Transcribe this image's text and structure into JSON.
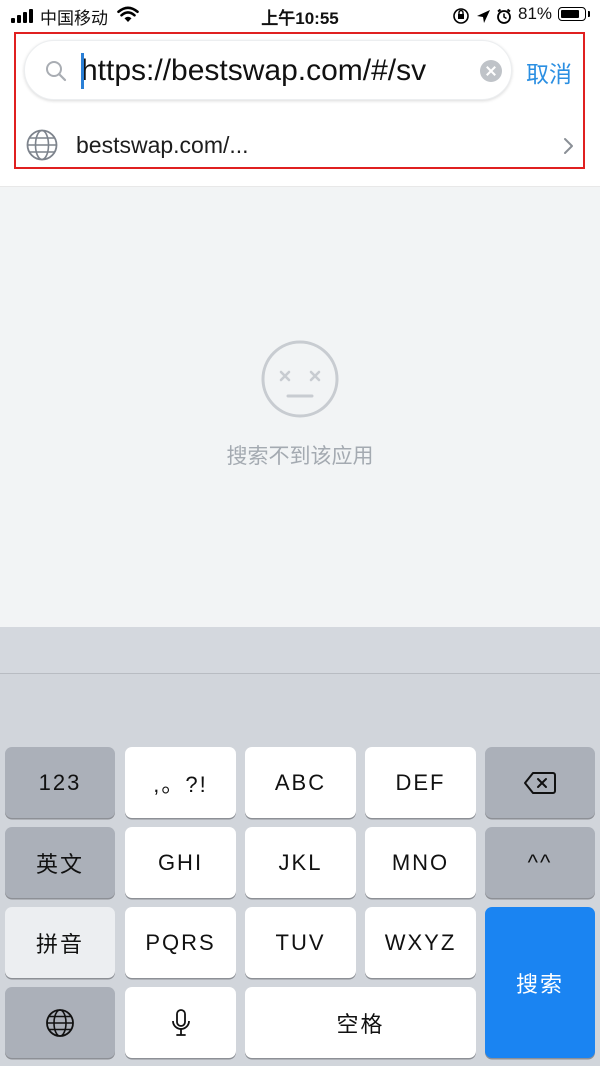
{
  "status_bar": {
    "carrier": "中国移动",
    "time": "上午10:55",
    "battery": "81%",
    "battery_level": 0.81
  },
  "search": {
    "value": "https://bestswap.com/#/sv",
    "cancel_label": "取消",
    "icons": [
      "search-icon",
      "clear-icon"
    ]
  },
  "suggestion": {
    "text": "bestswap.com/...",
    "icons": [
      "globe-icon",
      "chevron-right-icon"
    ]
  },
  "empty_state": {
    "message": "搜索不到该应用",
    "icon": "neutral-face-icon"
  },
  "keyboard": {
    "row1": [
      "123",
      ",。?!",
      "ABC",
      "DEF"
    ],
    "row2": [
      "英文",
      "GHI",
      "JKL",
      "MNO",
      "^^"
    ],
    "row3": [
      "拼音",
      "PQRS",
      "TUV",
      "WXYZ"
    ],
    "search_key": "搜索",
    "space_key": "空格",
    "icons": [
      "backspace-icon",
      "globe-icon",
      "microphone-icon"
    ]
  },
  "colors": {
    "accent": "#2b8fe2",
    "search_key": "#1a84f2",
    "highlight_border": "#e02020"
  }
}
